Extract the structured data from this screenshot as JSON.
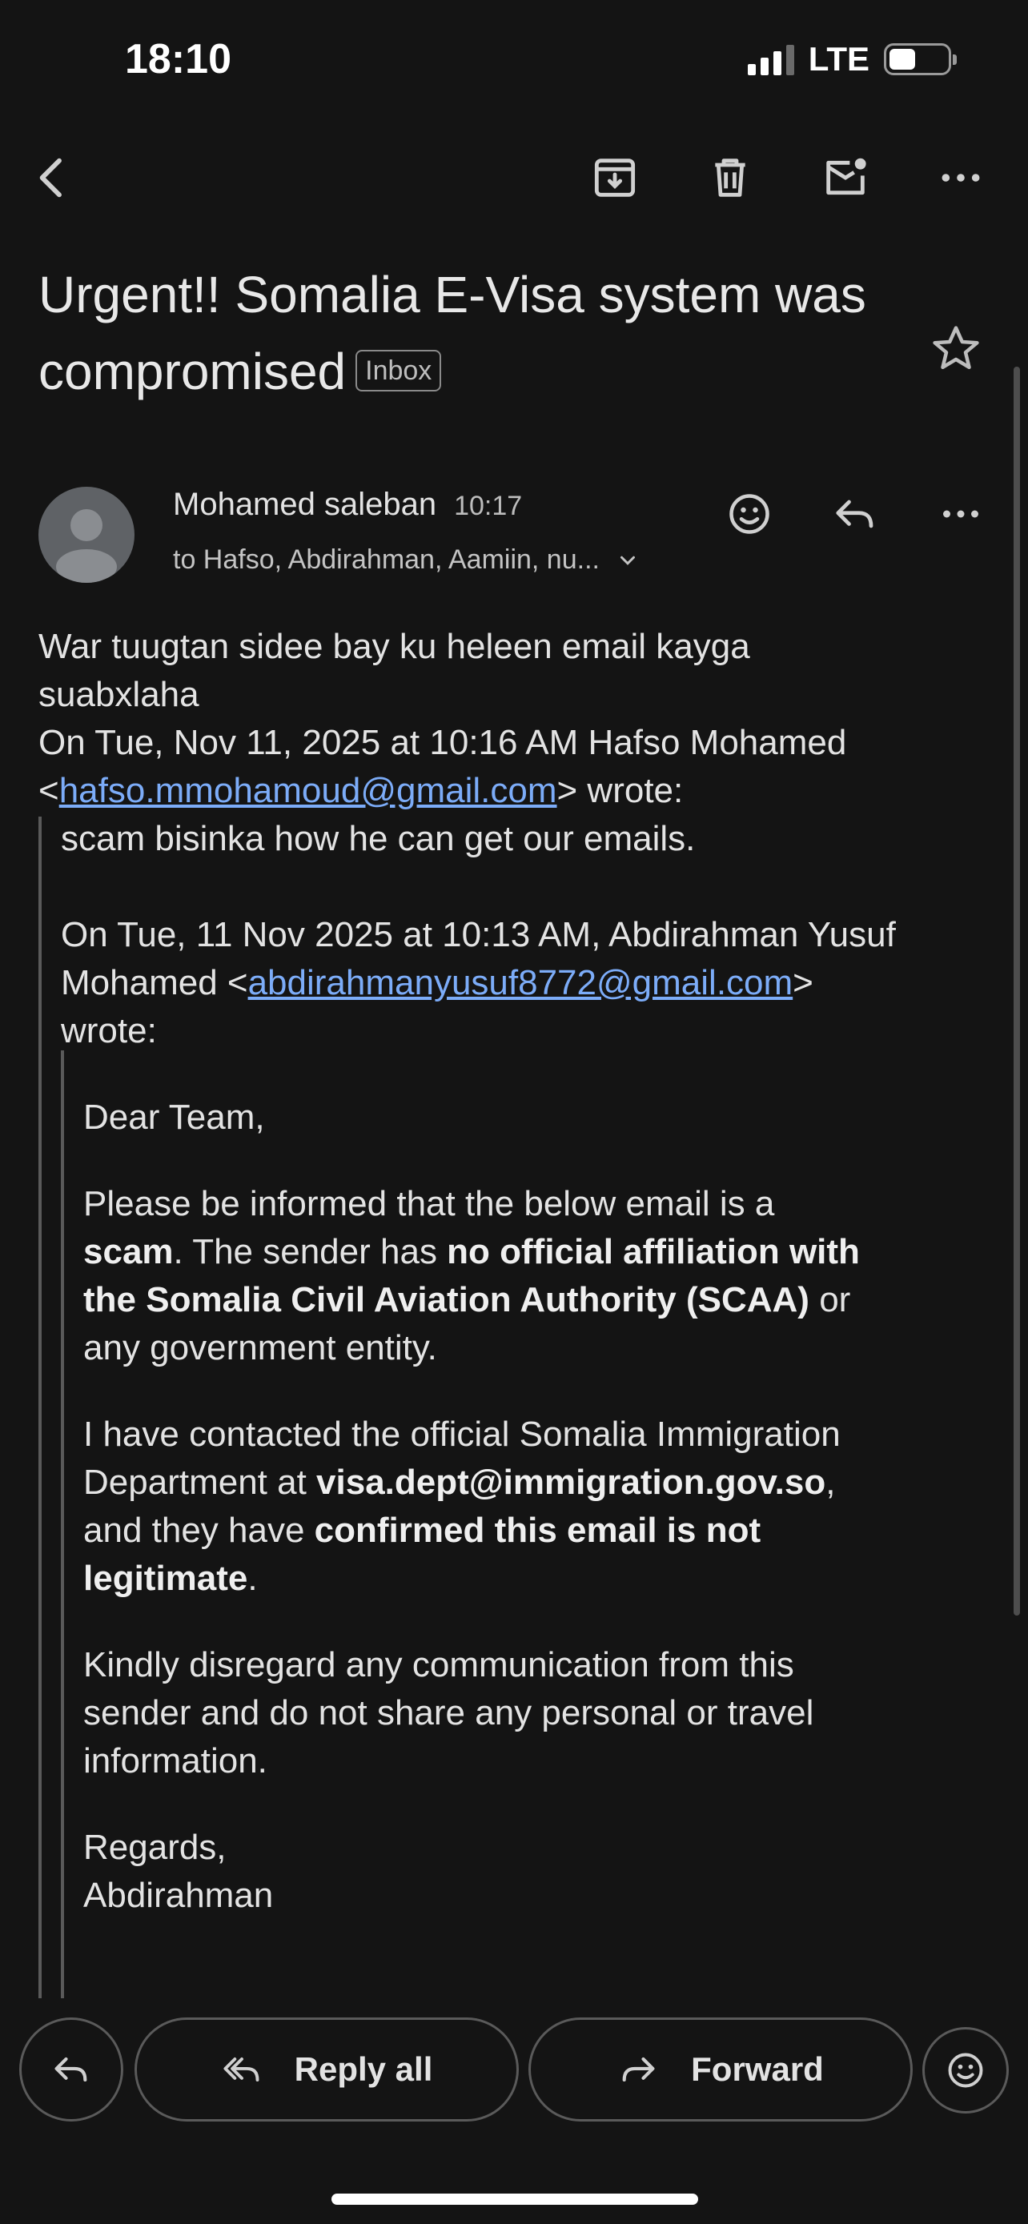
{
  "status_bar": {
    "time": "18:10",
    "network": "LTE",
    "battery_level": 0.45
  },
  "toolbar": {
    "icons": [
      "back-arrow-icon",
      "archive-icon",
      "trash-icon",
      "mark-unread-icon",
      "more-icon"
    ]
  },
  "email": {
    "subject": "Urgent!! Somalia E-Visa system was compromised",
    "label": "Inbox",
    "sender": "Mohamed saleban",
    "time": "10:17",
    "recipients": "to Hafso, Abdirahman, Aamiin, nu...",
    "reply_line1": "War tuugtan sidee bay ku heleen email kayga",
    "reply_line2": "suabxlaha",
    "quote1_header_1": "On Tue, Nov 11, 2025 at 10:16 AM Hafso Mohamed",
    "quote1_email": "hafso.mmohamoud@gmail.com",
    "quote1_lt": "<",
    "quote1_gt_wrote": "> wrote:",
    "quote1_text": "scam bisinka how he can get our emails.",
    "quote2_header_1": "On Tue, 11 Nov 2025 at 10:13 AM, Abdirahman Yusuf",
    "quote2_header_2_pre": "Mohamed <",
    "quote2_email": "abdirahmanyusuf8772@gmail.com",
    "quote2_header_2_post": ">",
    "quote2_wrote": "wrote:",
    "greeting": "Dear Team,",
    "p1_a": "Please be informed that the below email is a",
    "p1_b_bold": "scam",
    "p1_b": ". The sender has ",
    "p1_b_bold2": "no official affiliation with",
    "p1_c_bold": "the Somalia Civil Aviation Authority (SCAA)",
    "p1_c": " or",
    "p1_d": "any government entity.",
    "p2_a": "I have contacted the official Somalia Immigration",
    "p2_b": "Department at ",
    "p2_b_bold": "visa.dept@immigration.gov.so",
    "p2_b_end": ",",
    "p2_c": "and they have ",
    "p2_c_bold": "confirmed this email is not",
    "p2_d_bold": "legitimate",
    "p2_d": ".",
    "p3_a": "Kindly disregard any communication from this",
    "p3_b": "sender and do not share any personal or travel",
    "p3_c": "information.",
    "sign_1": "Regards,",
    "sign_2": "Abdirahman"
  },
  "actions": {
    "reply_all": "Reply all",
    "forward": "Forward"
  },
  "colors": {
    "background": "#141414",
    "link": "#7cacf8",
    "text": "#e3e3e3"
  }
}
